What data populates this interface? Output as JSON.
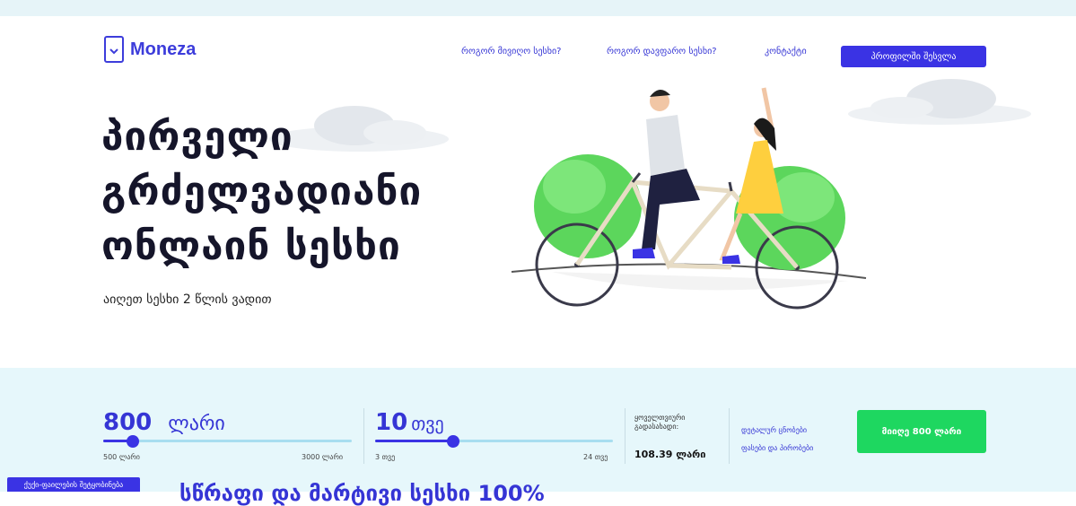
{
  "brand": {
    "name": "Moneza",
    "color": "#3d3ddb"
  },
  "nav": {
    "items": [
      "როგორ მივიღო სესხი?",
      "როგორ დავფარო სესხი?",
      "კონტაქტი"
    ],
    "cta": "პროფილში შესვლა"
  },
  "hero": {
    "title_lines": [
      "პირველი",
      "გრძელვადიანი",
      "ონლაინ სესხი"
    ],
    "subtitle": "აიღეთ სესხი 2 წლის ვადით"
  },
  "calculator": {
    "amount": {
      "value": "800",
      "unit": "ლარი",
      "min": "500 ლარი",
      "max": "3000 ლარი",
      "fraction": 0.12
    },
    "term": {
      "value": "10",
      "unit": "თვე",
      "min": "3 თვე",
      "max": "24 თვე",
      "fraction": 0.33
    },
    "total_label": "ყოველთვიური გადასახადი:",
    "total_value": "108.39 ლარი",
    "links": [
      "დეტალურ ცნობები",
      "ფასები და პირობები"
    ],
    "submit": "მიიღე 800 ლარი"
  },
  "cookie_tab": "ქუქი-ფაილების შეტყობინება",
  "bottom_heading": "სწრაფი და მარტივი სესხი 100%",
  "colors": {
    "accent": "#3a33e4",
    "success": "#1ed760",
    "calc_bg": "#e6f7fb"
  }
}
